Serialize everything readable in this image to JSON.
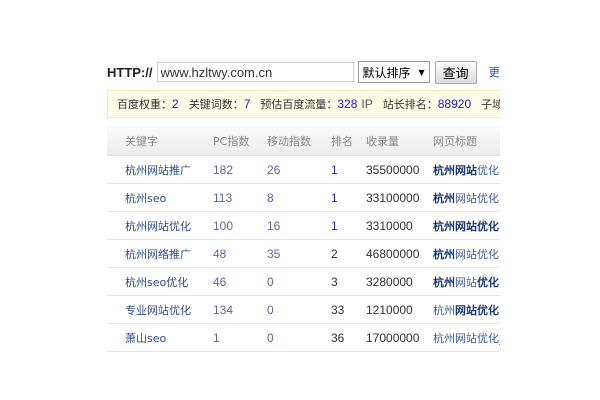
{
  "search": {
    "label": "HTTP://",
    "url": "www.hzltwy.com.cn",
    "sort": "默认排序",
    "submit": "查询",
    "more": "更多"
  },
  "info": [
    {
      "label": "百度权重：",
      "value": "2"
    },
    {
      "label": "关键词数：",
      "value": "7"
    },
    {
      "label": "预估百度流量：",
      "value": "328",
      "unit": "IP"
    },
    {
      "label": "站长排名：",
      "value": "88920"
    },
    {
      "label": "子域名",
      "value": ""
    }
  ],
  "table": {
    "headers": [
      "关键字",
      "PC指数",
      "移动指数",
      "排名",
      "收录量",
      "网页标题"
    ],
    "rows": [
      {
        "keyword": "杭州网站推广",
        "pc": "182",
        "mobile": "26",
        "rank": "1",
        "count": "35500000",
        "title": [
          {
            "t": "杭州网站",
            "b": true
          },
          {
            "t": "优化",
            "b": false
          }
        ]
      },
      {
        "keyword": "杭州seo",
        "pc": "113",
        "mobile": "8",
        "rank": "1",
        "count": "33100000",
        "title": [
          {
            "t": "杭州",
            "b": true
          },
          {
            "t": "网站优化",
            "b": false
          }
        ]
      },
      {
        "keyword": "杭州网站优化",
        "pc": "100",
        "mobile": "16",
        "rank": "1",
        "count": "3310000",
        "title": [
          {
            "t": "杭州网站优化",
            "b": true
          }
        ]
      },
      {
        "keyword": "杭州网络推广",
        "pc": "48",
        "mobile": "35",
        "rank": "2",
        "count": "46800000",
        "title": [
          {
            "t": "杭州",
            "b": true
          },
          {
            "t": "网站优化",
            "b": false
          }
        ]
      },
      {
        "keyword": "杭州seo优化",
        "pc": "46",
        "mobile": "0",
        "rank": "3",
        "count": "3280000",
        "title": [
          {
            "t": "杭州",
            "b": true
          },
          {
            "t": "网站",
            "b": false
          },
          {
            "t": "优化",
            "b": true
          }
        ]
      },
      {
        "keyword": "专业网站优化",
        "pc": "134",
        "mobile": "0",
        "rank": "33",
        "count": "1210000",
        "title": [
          {
            "t": "杭州",
            "b": false
          },
          {
            "t": "网站优化",
            "b": true
          }
        ]
      },
      {
        "keyword": "萧山seo",
        "pc": "1",
        "mobile": "0",
        "rank": "36",
        "count": "17000000",
        "title": [
          {
            "t": "杭州网站优化_",
            "b": false
          }
        ]
      }
    ]
  },
  "colors": {
    "link": "#2b4c8a",
    "value": "#1a1ad8",
    "info_bg": "#fefbe6"
  }
}
